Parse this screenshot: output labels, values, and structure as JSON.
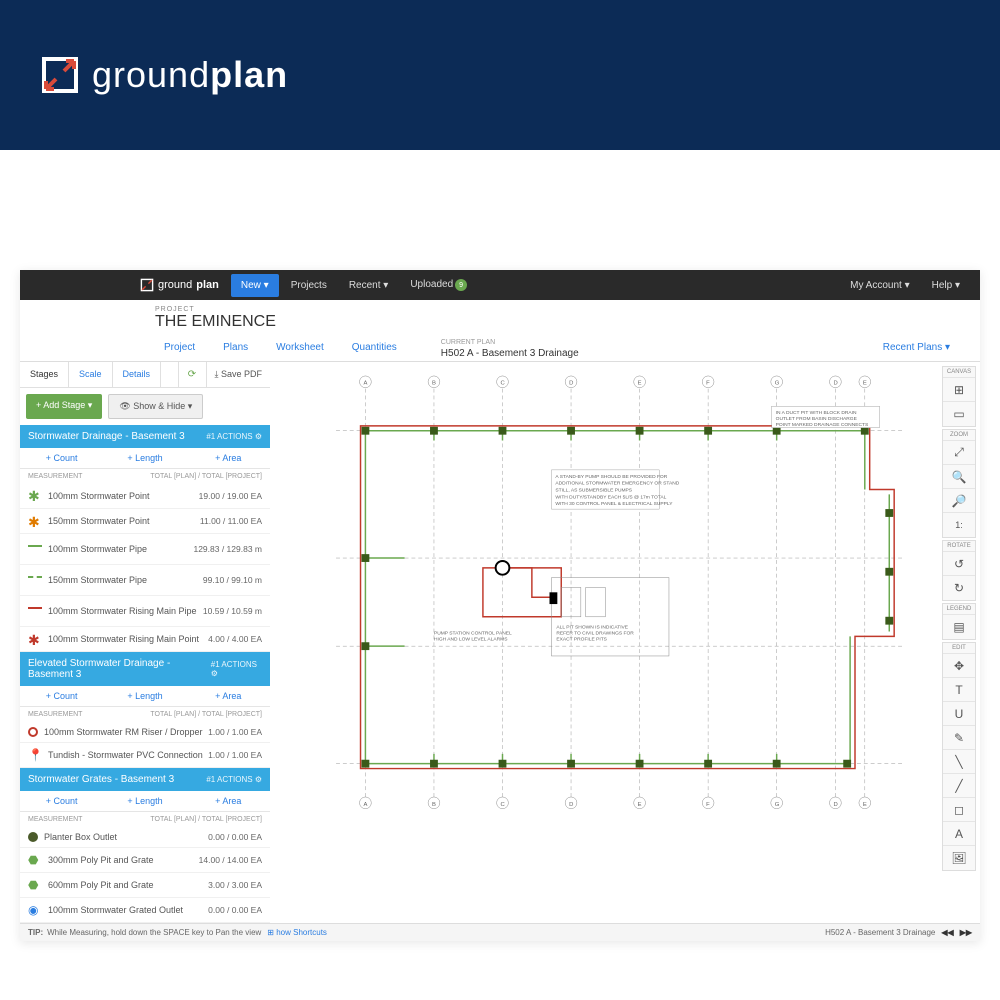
{
  "hero": {
    "brand_light": "ground",
    "brand_bold": "plan"
  },
  "topbar": {
    "brand_light": "ground",
    "brand_bold": "plan",
    "new": "New ▾",
    "projects": "Projects",
    "recent": "Recent ▾",
    "uploaded": "Uploaded",
    "uploaded_badge": "9",
    "my_account": "My Account ▾",
    "help": "Help ▾"
  },
  "subheader": {
    "label": "PROJECT",
    "title": "THE EMINENCE"
  },
  "tabs": {
    "project": "Project",
    "plans": "Plans",
    "worksheet": "Worksheet",
    "quantities": "Quantities"
  },
  "plan_box": {
    "label": "CURRENT PLAN",
    "name": "H502 A - Basement 3 Drainage"
  },
  "recent_plans": "Recent Plans ▾",
  "side_toolbar": {
    "stages": "Stages",
    "scale": "Scale",
    "details": "Details",
    "save_pdf": "⤓ Save PDF"
  },
  "side_actions": {
    "add_stage": "+ Add Stage ▾",
    "show_hide": "👁 Show & Hide ▾"
  },
  "sub_actions": {
    "count": "+ Count",
    "length": "+ Length",
    "area": "+ Area"
  },
  "tbl_head": {
    "left": "MEASUREMENT",
    "right": "TOTAL [PLAN] / TOTAL [PROJECT]"
  },
  "group_actions": "#1   ACTIONS ⚙",
  "groups": [
    {
      "title": "Stormwater Drainage - Basement 3",
      "rows": [
        {
          "sym": "star-g",
          "name": "100mm Stormwater Point",
          "val": "19.00 /  19.00 EA"
        },
        {
          "sym": "star-o",
          "name": "150mm Stormwater Point",
          "val": "11.00 /  11.00 EA"
        },
        {
          "sym": "line-g",
          "name": "100mm Stormwater Pipe",
          "val": "129.83 /  129.83 m"
        },
        {
          "sym": "line-gd",
          "name": "150mm Stormwater Pipe",
          "val": "99.10 /  99.10 m"
        },
        {
          "sym": "line-r",
          "name": "100mm Stormwater Rising Main Pipe",
          "val": "10.59 /  10.59 m"
        },
        {
          "sym": "star-r",
          "name": "100mm Stormwater Rising Main Point",
          "val": "4.00 /  4.00 EA"
        }
      ]
    },
    {
      "title": "Elevated Stormwater Drainage - Basement 3",
      "rows": [
        {
          "sym": "circ-r",
          "name": "100mm Stormwater RM Riser / Dropper",
          "val": "1.00 /  1.00 EA"
        },
        {
          "sym": "pin-g",
          "name": "Tundish - Stormwater PVC Connection",
          "val": "1.00 /  1.00 EA"
        }
      ]
    },
    {
      "title": "Stormwater Grates - Basement 3",
      "rows": [
        {
          "sym": "circ-dk",
          "name": "Planter Box Outlet",
          "val": "0.00 /  0.00 EA"
        },
        {
          "sym": "hex-g",
          "name": "300mm Poly Pit and Grate",
          "val": "14.00 /  14.00 EA"
        },
        {
          "sym": "hex-g",
          "name": "600mm Poly Pit and Grate",
          "val": "3.00 /  3.00 EA"
        },
        {
          "sym": "circ-bl",
          "name": "100mm Stormwater Grated Outlet",
          "val": "0.00 /  0.00 EA"
        }
      ]
    }
  ],
  "right_toolbar": {
    "canvas": "CANVAS",
    "zoom": "ZOOM",
    "rotate": "ROTATE",
    "legend": "LEGEND",
    "edit": "EDIT"
  },
  "footer": {
    "tip_label": "TIP:",
    "tip": "While Measuring, hold down the  SPACE  key to Pan the view",
    "link": "⊞ how Shortcuts",
    "plan_name": "H502 A - Basement 3 Drainage"
  }
}
